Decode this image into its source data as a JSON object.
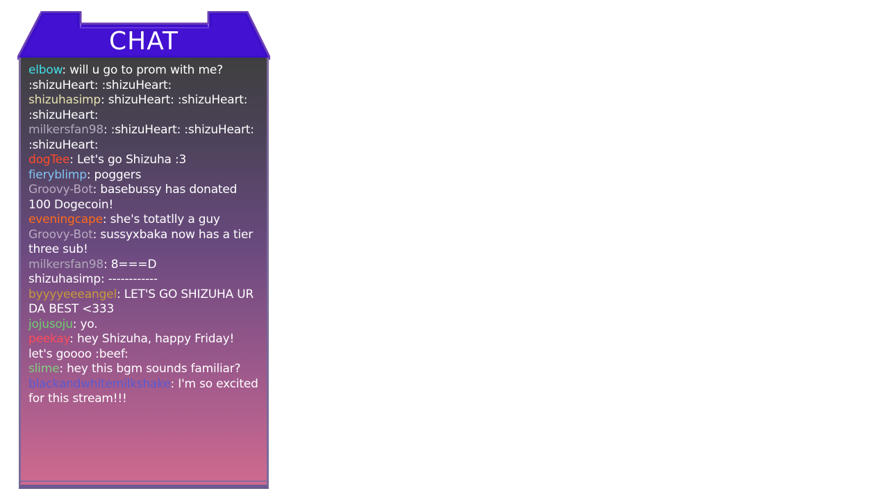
{
  "header": {
    "title": "CHAT"
  },
  "colors": {
    "header_fill": "#3a0fc8",
    "header_border": "#6b3fb6",
    "body_top": "#3f3f3f",
    "body_bottom": "#cf6a8f"
  },
  "messages": [
    {
      "user": "elbow",
      "color": "#3fe0e8",
      "text": "will u go to prom with me? :shizuHeart: :shizuHeart:"
    },
    {
      "user": "shizuhasimp",
      "color": "#e6e2b0",
      "text": "shizuHeart: :shizuHeart: :shizuHeart:"
    },
    {
      "user": "milkersfan98",
      "color": "#b0a9ba",
      "text": ":shizuHeart: :shizuHeart: :shizuHeart:"
    },
    {
      "user": "dogTee",
      "color": "#ff4a2a",
      "text": "Let's go Shizuha :3"
    },
    {
      "user": "fieryblimp",
      "color": "#7fc4f2",
      "text": "poggers"
    },
    {
      "user": "Groovy-Bot",
      "color": "#b8a9c0",
      "text": "basebussy has donated 100 Dogecoin!"
    },
    {
      "user": "eveningcape",
      "color": "#ff6a1a",
      "text": "she's totatlly a guy"
    },
    {
      "user": "Groovy-Bot",
      "color": "#b8a9c0",
      "text": "sussyxbaka now has a tier three sub!"
    },
    {
      "user": "milkersfan98",
      "color": "#b0a9ba",
      "text": "8===D"
    },
    {
      "user": "shizuhasimp",
      "color": "#ffffff",
      "text": "------------"
    },
    {
      "user": "byyyyeeeangel",
      "color": "#c89a3a",
      "text": "LET'S GO SHIZUHA UR DA BEST <333"
    },
    {
      "user": "jojusoju",
      "color": "#6fd06f",
      "text": "yo."
    },
    {
      "user": "peekay",
      "color": "#ff4a5a",
      "text": "hey Shizuha, happy Friday! let's goooo :beef:"
    },
    {
      "user": "slime",
      "color": "#7fd07f",
      "text": "hey this bgm sounds familiar?"
    },
    {
      "user": "blackandwhitemilkshake",
      "color": "#5a5ad0",
      "text": "I'm so excited for this stream!!!"
    }
  ]
}
